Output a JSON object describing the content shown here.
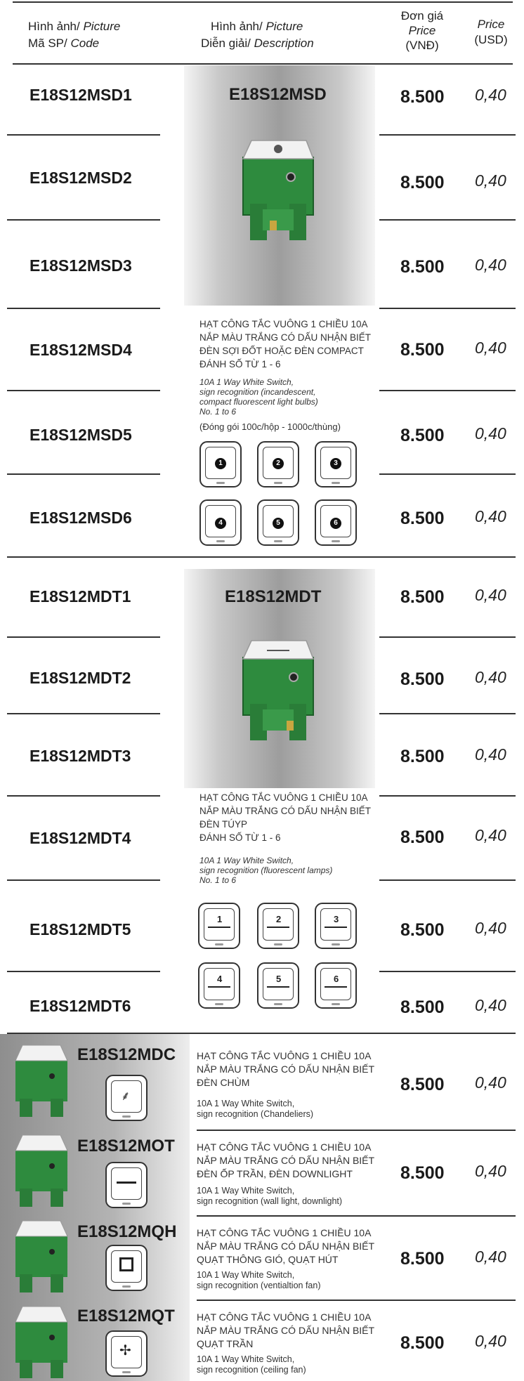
{
  "header": {
    "col1_line1_vi": "Hình ảnh/",
    "col1_line1_en": "Picture",
    "col1_line2_vi": "Mã SP/",
    "col1_line2_en": "Code",
    "col2_line1_vi": "Hình ảnh/",
    "col2_line1_en": "Picture",
    "col2_line2_vi": "Diễn giải/",
    "col2_line2_en": "Description",
    "col3_line1": "Đơn giá",
    "col3_line2": "Price",
    "col3_line3": "(VNĐ)",
    "col4_line1": "Price",
    "col4_line2": "(USD)"
  },
  "groups": {
    "msd": {
      "title": "E18S12MSD",
      "desc_vi": [
        "HẠT CÔNG TẮC VUÔNG 1 CHIỀU 10A",
        "NẮP MÀU TRẮNG CÓ DẤU NHẬN BIẾT",
        "ĐÈN SỢI ĐỐT HOẶC ĐÈN COMPACT",
        "ĐÁNH SỐ TỪ 1 - 6"
      ],
      "desc_en": [
        "10A 1 Way White Switch,",
        "sign recognition (incandescent,",
        "compact fluorescent light bulbs)",
        "No. 1 to 6"
      ],
      "pack": "(Đóng gói 100c/hộp - 1000c/thùng)",
      "icon_numbers": [
        "1",
        "2",
        "3",
        "4",
        "5",
        "6"
      ]
    },
    "mdt": {
      "title": "E18S12MDT",
      "desc_vi": [
        "HẠT CÔNG TẮC VUÔNG 1 CHIỀU 10A",
        "NẮP MÀU TRẮNG CÓ DẤU NHẬN BIẾT",
        "ĐÈN TÚYP",
        "ĐÁNH SỐ TỪ 1 - 6"
      ],
      "desc_en": [
        "10A 1 Way White Switch,",
        "sign recognition (fluorescent lamps)",
        "No. 1 to 6"
      ],
      "icon_numbers": [
        "1",
        "2",
        "3",
        "4",
        "5",
        "6"
      ]
    }
  },
  "rows": [
    {
      "code": "E18S12MSD1",
      "vnd": "8.500",
      "usd": "0,40"
    },
    {
      "code": "E18S12MSD2",
      "vnd": "8.500",
      "usd": "0,40"
    },
    {
      "code": "E18S12MSD3",
      "vnd": "8.500",
      "usd": "0,40"
    },
    {
      "code": "E18S12MSD4",
      "vnd": "8.500",
      "usd": "0,40"
    },
    {
      "code": "E18S12MSD5",
      "vnd": "8.500",
      "usd": "0,40"
    },
    {
      "code": "E18S12MSD6",
      "vnd": "8.500",
      "usd": "0,40"
    },
    {
      "code": "E18S12MDT1",
      "vnd": "8.500",
      "usd": "0,40"
    },
    {
      "code": "E18S12MDT2",
      "vnd": "8.500",
      "usd": "0,40"
    },
    {
      "code": "E18S12MDT3",
      "vnd": "8.500",
      "usd": "0,40"
    },
    {
      "code": "E18S12MDT4",
      "vnd": "8.500",
      "usd": "0,40"
    },
    {
      "code": "E18S12MDT5",
      "vnd": "8.500",
      "usd": "0,40"
    },
    {
      "code": "E18S12MDT6",
      "vnd": "8.500",
      "usd": "0,40"
    }
  ],
  "single": [
    {
      "code": "E18S12MDC",
      "desc_vi": [
        "HẠT CÔNG TẮC VUÔNG 1 CHIỀU 10A",
        "NẮP MÀU TRẮNG CÓ DẤU NHẬN BIẾT",
        "ĐÈN CHÙM"
      ],
      "desc_en": [
        "10A 1 Way White Switch,",
        "sign recognition (Chandeliers)"
      ],
      "vnd": "8.500",
      "usd": "0,40",
      "icon": "chandelier-icon"
    },
    {
      "code": "E18S12MOT",
      "desc_vi": [
        "HẠT CÔNG TẮC VUÔNG 1 CHIỀU 10A",
        "NẮP MÀU TRẮNG CÓ DẤU NHẬN BIẾT",
        "ĐÈN ỐP TRẦN, ĐÈN DOWNLIGHT"
      ],
      "desc_en": [
        "10A 1 Way White Switch,",
        "sign recognition (wall light, downlight)"
      ],
      "vnd": "8.500",
      "usd": "0,40",
      "icon": "downlight-icon"
    },
    {
      "code": "E18S12MQH",
      "desc_vi": [
        "HẠT CÔNG TẮC VUÔNG 1 CHIỀU 10A",
        "NẮP MÀU TRẮNG CÓ DẤU NHẬN BIẾT",
        "QUẠT THÔNG GIÓ, QUẠT HÚT"
      ],
      "desc_en": [
        "10A 1 Way White Switch,",
        "sign recognition (ventialtion fan)"
      ],
      "vnd": "8.500",
      "usd": "0,40",
      "icon": "ventilation-fan-icon"
    },
    {
      "code": "E18S12MQT",
      "desc_vi": [
        "HẠT CÔNG TẮC VUÔNG 1 CHIỀU 10A",
        "NẮP MÀU TRẮNG CÓ DẤU NHẬN BIẾT",
        "QUẠT TRẦN"
      ],
      "desc_en": [
        "10A 1 Way White Switch,",
        "sign recognition (ceiling fan)"
      ],
      "vnd": "8.500",
      "usd": "0,40",
      "icon": "ceiling-fan-icon"
    }
  ],
  "colors": {
    "switch_green": "#2e8b3e",
    "switch_white": "#f2f2f2",
    "grey_panel": "#9d9d9d"
  }
}
